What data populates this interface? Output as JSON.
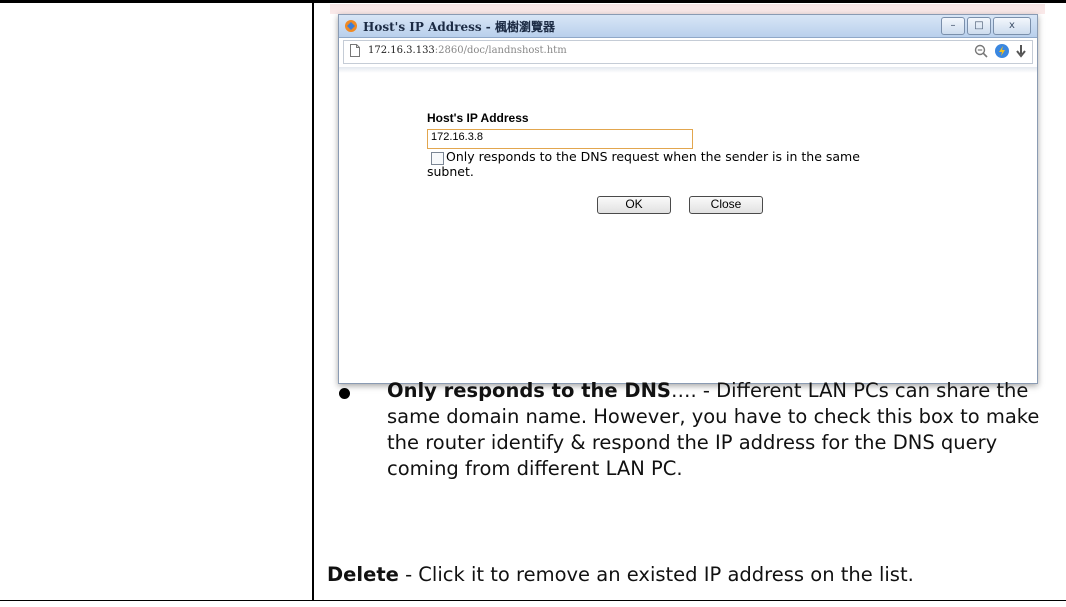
{
  "dialog": {
    "window_title": "Host's IP Address - 楓樹瀏覽器",
    "url_host": "172.16.3.133",
    "url_rest": ":2860/doc/landnshost.htm",
    "field_label": "Host's IP Address",
    "ip_value": "172.16.3.8",
    "checkbox_checked": false,
    "checkbox_text_line1": "Only responds to the DNS request when the sender is in the same",
    "checkbox_text_line2": "subnet.",
    "ok_label": "OK",
    "close_label": "Close",
    "minimize_glyph": "–",
    "maximize_glyph": "□",
    "close_glyph": "x"
  },
  "doc": {
    "bullet_term": "Only responds to the DNS",
    "bullet_ellipsis": "….",
    "bullet_text": " - Different LAN PCs can share the same domain name. However, you have to check this box to make the router identify & respond the IP address for the DNS query coming from different LAN PC.",
    "delete_term": "Delete",
    "delete_text": " - Click it to remove an existed IP address on the list."
  },
  "colors": {
    "input_border": "#e2a64e",
    "titlebar": "#b9d0ec"
  }
}
